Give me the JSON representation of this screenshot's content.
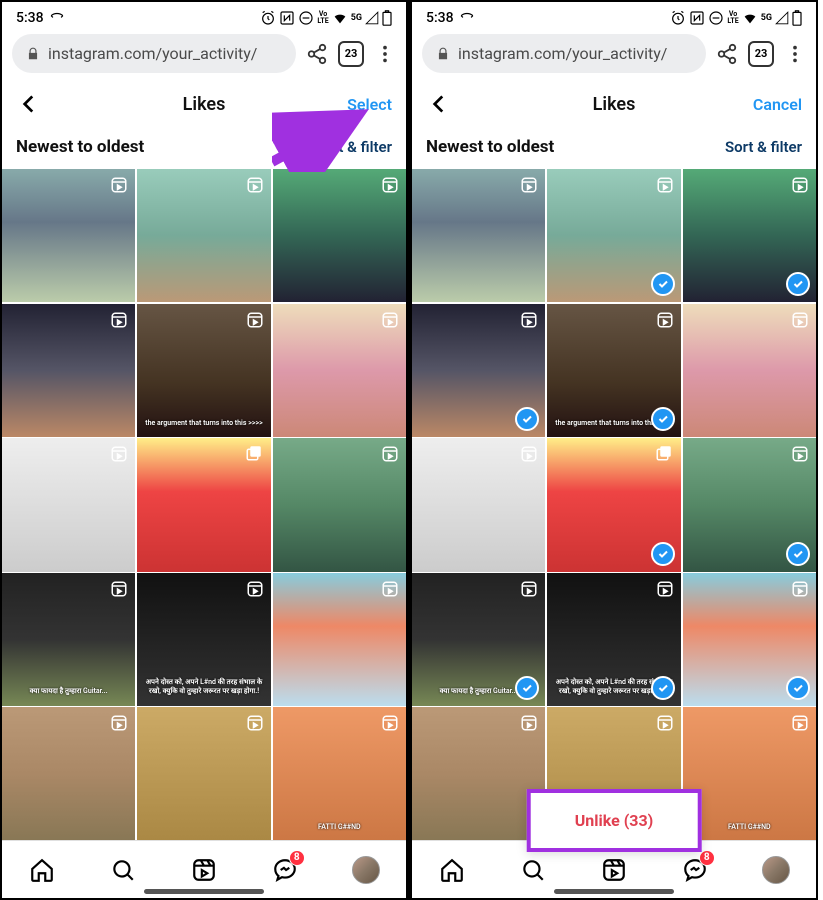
{
  "status": {
    "time": "5:38",
    "tab_count": "23"
  },
  "url_bar": {
    "url_text": "instagram.com/your_activity/"
  },
  "left": {
    "header_title": "Likes",
    "header_action": "Select",
    "sort_label": "Newest to oldest",
    "sort_filter": "Sort & filter",
    "messages_badge": "8"
  },
  "right": {
    "header_title": "Likes",
    "header_action": "Cancel",
    "sort_label": "Newest to oldest",
    "sort_filter": "Sort & filter",
    "messages_badge": "8",
    "unlike_label": "Unlike (33)"
  },
  "cells": [
    {
      "type": "reel",
      "bg": "linear-gradient(180deg,#8aa 0%,#678 40%,#bca 100%)",
      "selected": false
    },
    {
      "type": "reel",
      "bg": "linear-gradient(180deg,#9cb 0%,#7a9 50%,#b97 100%)",
      "selected": true
    },
    {
      "type": "reel",
      "bg": "linear-gradient(180deg,#5a7 0%,#365 50%,#223 100%)",
      "selected": true
    },
    {
      "type": "reel",
      "bg": "linear-gradient(180deg,#223 0%,#556 50%,#b86 100%)",
      "selected": true
    },
    {
      "type": "reel",
      "bg": "linear-gradient(180deg,#654 0%,#432 60%,#211 100%)",
      "selected": true,
      "text": "the argument that turns into this >>>>"
    },
    {
      "type": "reel",
      "bg": "linear-gradient(180deg,#edb 0%,#d9a 50%,#c87 100%)",
      "selected": false
    },
    {
      "type": "reel",
      "bg": "linear-gradient(180deg,#eee 0%,#ddd 50%,#ccc 100%)",
      "selected": false
    },
    {
      "type": "carousel",
      "bg": "linear-gradient(180deg,#fe8 0%,#e44 40%,#c33 100%)",
      "selected": true
    },
    {
      "type": "reel",
      "bg": "linear-gradient(180deg,#7a8 0%,#586 50%,#354 100%)",
      "selected": true
    },
    {
      "type": "reel",
      "bg": "linear-gradient(180deg,#222 0%,#333 50%,#785 100%)",
      "selected": true,
      "text": "क्या फायदा है तुम्हारा Guitar..."
    },
    {
      "type": "reel",
      "bg": "linear-gradient(180deg,#111 0%,#222 50%,#333 100%)",
      "selected": true,
      "text": "अपने दोस्त को, अपने L#nd की तरह संभाल के रखो, क्युकि वो तुम्हारे जरूरत पर खड़ा होगा.!"
    },
    {
      "type": "reel",
      "bg": "linear-gradient(180deg,#8cd 0%,#e86 40%,#bde 100%)",
      "selected": true
    },
    {
      "type": "reel",
      "bg": "linear-gradient(180deg,#b97 0%,#a86 50%,#875 100%)",
      "selected": false
    },
    {
      "type": "reel",
      "bg": "linear-gradient(180deg,#ca6 0%,#b95 50%,#a84 100%)",
      "selected": false
    },
    {
      "type": "reel",
      "bg": "linear-gradient(180deg,#e96 0%,#d85 50%,#c74 100%)",
      "selected": false,
      "text": "FATTI G##ND"
    }
  ]
}
